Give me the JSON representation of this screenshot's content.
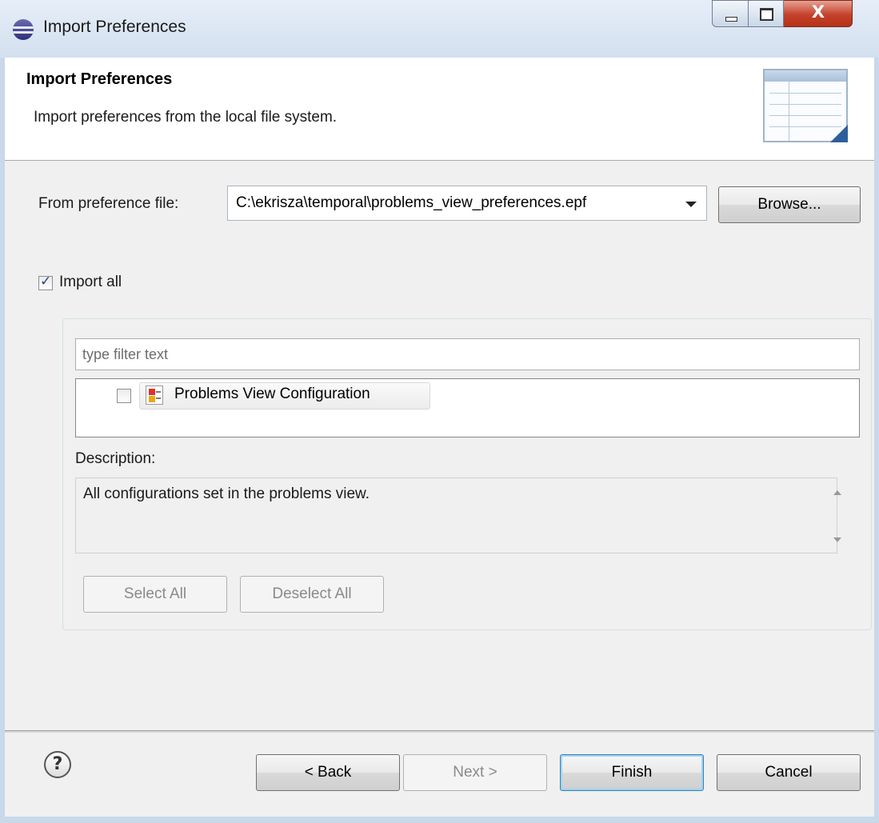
{
  "window": {
    "title": "Import Preferences",
    "buttons": {
      "close_glyph": "X"
    }
  },
  "banner": {
    "title": "Import Preferences",
    "description": "Import preferences from the local file system."
  },
  "source": {
    "label": "From preference file:",
    "value": "C:\\ekrisza\\temporal\\problems_view_preferences.epf",
    "browse_label": "Browse..."
  },
  "import_all": {
    "label": "Import all",
    "checked": true
  },
  "filter": {
    "placeholder": "type filter text"
  },
  "tree": {
    "items": [
      {
        "label": "Problems View Configuration",
        "checked": false,
        "icon": "problems-view-icon"
      }
    ]
  },
  "description": {
    "label": "Description:",
    "text": "All configurations set in the problems view."
  },
  "selection_buttons": {
    "select_all": "Select All",
    "deselect_all": "Deselect All"
  },
  "footer": {
    "help_glyph": "?",
    "back": "< Back",
    "next": "Next >",
    "finish": "Finish",
    "cancel": "Cancel"
  },
  "colors": {
    "titlebar": "#d3e0ef",
    "close_button": "#c4412a",
    "dialog_bg": "#f0f0f0",
    "banner_bg": "#ffffff",
    "default_button_focus": "#3c7fb1"
  }
}
